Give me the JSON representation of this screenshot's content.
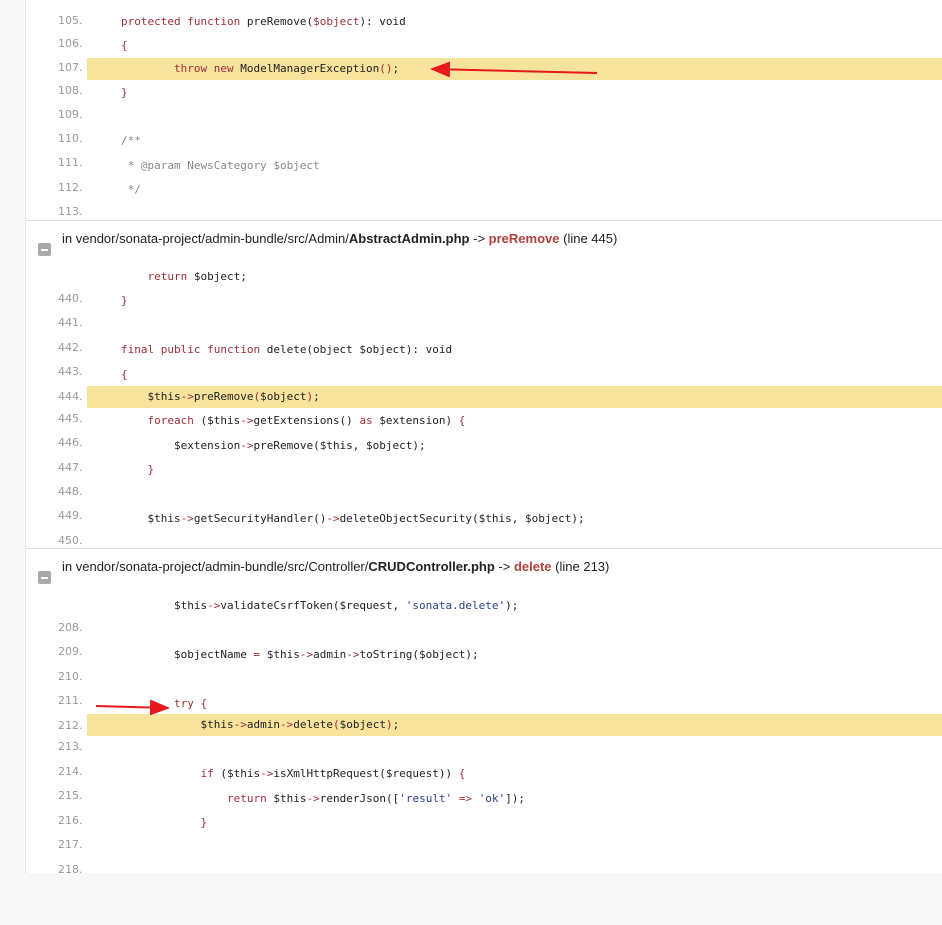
{
  "frame1": {
    "lines": [
      {
        "no": "105.",
        "code": ""
      },
      {
        "no": "106.",
        "code": "protected function preRemove($object): void"
      },
      {
        "no": "107.",
        "code": "{"
      },
      {
        "no": "108.",
        "code": "        throw new ModelManagerException();"
      },
      {
        "no": "109.",
        "code": "}"
      },
      {
        "no": "110.",
        "code": ""
      },
      {
        "no": "111.",
        "code": "/**"
      },
      {
        "no": "112.",
        "code": " * @param NewsCategory $object"
      },
      {
        "no": "113.",
        "code": " */"
      }
    ]
  },
  "frame2": {
    "prefix": "in vendor/sonata-project/admin-bundle/src/Admin/",
    "file": "AbstractAdmin.php",
    "arrow": "->",
    "function": "preRemove",
    "line_info": "(line 445)",
    "lines": [
      {
        "no": "440.",
        "code": "    return $object;"
      },
      {
        "no": "441.",
        "code": "}"
      },
      {
        "no": "442.",
        "code": ""
      },
      {
        "no": "443.",
        "code": "final public function delete(object $object): void"
      },
      {
        "no": "444.",
        "code": "{"
      },
      {
        "no": "445.",
        "code": "    $this->preRemove($object);"
      },
      {
        "no": "446.",
        "code": "    foreach ($this->getExtensions() as $extension) {"
      },
      {
        "no": "447.",
        "code": "        $extension->preRemove($this, $object);"
      },
      {
        "no": "448.",
        "code": "    }"
      },
      {
        "no": "449.",
        "code": ""
      },
      {
        "no": "450.",
        "code": "    $this->getSecurityHandler()->deleteObjectSecurity($this, $object);"
      }
    ]
  },
  "frame3": {
    "prefix": "in vendor/sonata-project/admin-bundle/src/Controller/",
    "file": "CRUDController.php",
    "arrow": "->",
    "function": "delete",
    "line_info": "(line 213)",
    "lines": [
      {
        "no": "208.",
        "code": "        $this->validateCsrfToken($request, 'sonata.delete');"
      },
      {
        "no": "209.",
        "code": ""
      },
      {
        "no": "210.",
        "code": "        $objectName = $this->admin->toString($object);"
      },
      {
        "no": "211.",
        "code": ""
      },
      {
        "no": "212.",
        "code": "        try {"
      },
      {
        "no": "213.",
        "code": "            $this->admin->delete($object);"
      },
      {
        "no": "214.",
        "code": ""
      },
      {
        "no": "215.",
        "code": "            if ($this->isXmlHttpRequest($request)) {"
      },
      {
        "no": "216.",
        "code": "                return $this->renderJson(['result' => 'ok']);"
      },
      {
        "no": "217.",
        "code": "            }"
      },
      {
        "no": "218.",
        "code": ""
      }
    ]
  },
  "colors": {
    "highlight": "#f7e39b",
    "keyword": "#a1303a",
    "function_name": "#b0413e",
    "annotation_arrow": "#e8191b"
  }
}
